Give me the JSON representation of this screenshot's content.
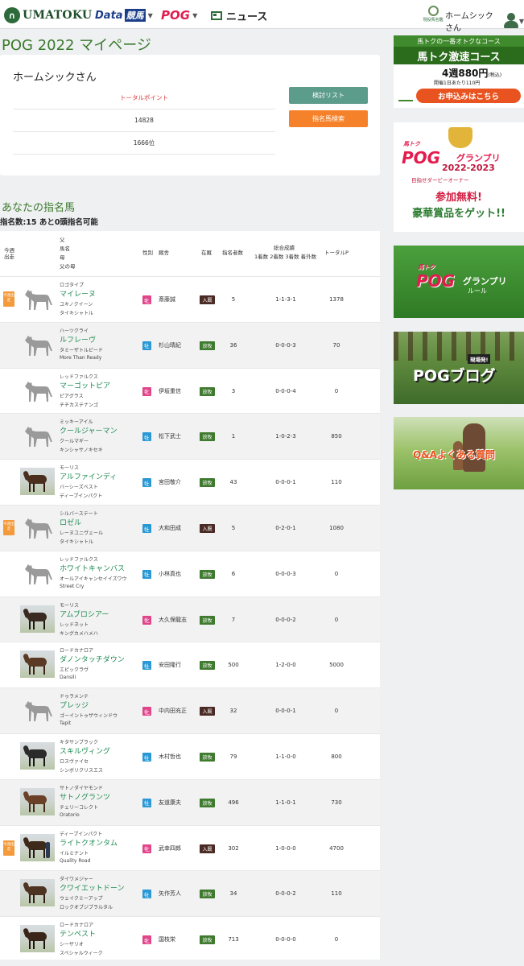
{
  "header": {
    "logo_text": "UMATOKU",
    "nav": [
      {
        "label": "Data",
        "sub": "競馬"
      },
      {
        "label": "POG"
      },
      {
        "label": "ニュース"
      }
    ],
    "corner_label": "現役馬名鑑",
    "user_name": "ホームシックさん"
  },
  "page_title": "POG 2022 マイページ",
  "profile": {
    "name": "ホームシックさん",
    "stat_label": "トータルポイント",
    "points": "14828",
    "rank": "1666位",
    "btn_list": "検討リスト",
    "btn_search": "指名馬検索"
  },
  "horses_section": {
    "title": "あなたの指名馬",
    "count_text": "指名数:15 あと0頭指名可能",
    "headers": {
      "konshu": "今週",
      "shusou": "出走",
      "sire": "父",
      "name": "馬名",
      "dam": "母",
      "damsire": "父の母",
      "sex": "性別",
      "trainer": "厩舎",
      "stable": "在厩",
      "noms": "指名者数",
      "record_title": "総合成績",
      "record_sub": "1着数 2着数 3着数 着外数",
      "points": "トータルP"
    }
  },
  "horses": [
    {
      "badge": "今週出走",
      "thumb": "silhouette",
      "sire": "ロゴタイプ",
      "name": "マイレーヌ",
      "dam": "ユキノクイーン",
      "damsire": "タイキシャトル",
      "sex": "牝",
      "trainer": "斎藤誠",
      "stable": "入厩",
      "noms": "5",
      "record": "1-1-3-1",
      "points": "1378"
    },
    {
      "badge": "",
      "thumb": "silhouette",
      "sire": "ハーツクライ",
      "name": "ルフレーヴ",
      "dam": "タミーザトルピード",
      "damsire": "More Than Ready",
      "sex": "牡",
      "trainer": "杉山晴紀",
      "stable": "放牧",
      "noms": "36",
      "record": "0-0-0-3",
      "points": "70"
    },
    {
      "badge": "",
      "thumb": "silhouette",
      "sire": "レッドファルクス",
      "name": "マーゴットピア",
      "dam": "ピアグラス",
      "damsire": "チチカステナンゴ",
      "sex": "牝",
      "trainer": "伊坂重信",
      "stable": "放牧",
      "noms": "3",
      "record": "0-0-0-4",
      "points": "0"
    },
    {
      "badge": "",
      "thumb": "silhouette",
      "sire": "ミッキーアイル",
      "name": "クールジャーマン",
      "dam": "クールマギー",
      "damsire": "キンシャサノキセキ",
      "sex": "牡",
      "trainer": "松下武士",
      "stable": "放牧",
      "noms": "1",
      "record": "1-0-2-3",
      "points": "850"
    },
    {
      "badge": "",
      "thumb": "photo",
      "sire": "モーリス",
      "name": "アルファインディ",
      "dam": "バーシーズベスト",
      "damsire": "ディープインパクト",
      "sex": "牡",
      "trainer": "宮田敬介",
      "stable": "放牧",
      "noms": "43",
      "record": "0-0-0-1",
      "points": "110"
    },
    {
      "badge": "今週出走",
      "thumb": "silhouette",
      "sire": "シルバーステート",
      "name": "ロゼル",
      "dam": "レーヌユニヴェール",
      "damsire": "タイキシャトル",
      "sex": "牡",
      "trainer": "大和田成",
      "stable": "入厩",
      "noms": "5",
      "record": "0-2-0-1",
      "points": "1080"
    },
    {
      "badge": "",
      "thumb": "silhouette",
      "sire": "レッドファルクス",
      "name": "ホワイトキャンバス",
      "dam": "オールアイキャンセイイズワウ",
      "damsire": "Street Cry",
      "sex": "牡",
      "trainer": "小林真也",
      "stable": "放牧",
      "noms": "6",
      "record": "0-0-0-3",
      "points": "0"
    },
    {
      "badge": "",
      "thumb": "photo",
      "sire": "モーリス",
      "name": "アムブロシアー",
      "dam": "レッドネット",
      "damsire": "キングカメハメハ",
      "sex": "牝",
      "trainer": "大久保龍志",
      "stable": "放牧",
      "noms": "7",
      "record": "0-0-0-2",
      "points": "0"
    },
    {
      "badge": "",
      "thumb": "photo",
      "sire": "ロードカナロア",
      "name": "ダノンタッチダウン",
      "dam": "エピックラヴ",
      "damsire": "Dansili",
      "sex": "牡",
      "trainer": "安田隆行",
      "stable": "放牧",
      "noms": "500",
      "record": "1-2-0-0",
      "points": "5000"
    },
    {
      "badge": "",
      "thumb": "silhouette",
      "sire": "ドゥラメンテ",
      "name": "プレッジ",
      "dam": "ゴーイントゥザウィンドウ",
      "damsire": "Tapit",
      "sex": "牝",
      "trainer": "中内田充正",
      "stable": "入厩",
      "noms": "32",
      "record": "0-0-0-1",
      "points": "0"
    },
    {
      "badge": "",
      "thumb": "photo",
      "sire": "キタサンブラック",
      "name": "スキルヴィング",
      "dam": "ロスヴァイセ",
      "damsire": "シンボリクリスエス",
      "sex": "牡",
      "trainer": "木村哲也",
      "stable": "放牧",
      "noms": "79",
      "record": "1-1-0-0",
      "points": "800"
    },
    {
      "badge": "",
      "thumb": "photo",
      "sire": "サトノダイヤモンド",
      "name": "サトノグランツ",
      "dam": "チェリーコレクト",
      "damsire": "Oratorio",
      "sex": "牡",
      "trainer": "友道康夫",
      "stable": "放牧",
      "noms": "496",
      "record": "1-1-0-1",
      "points": "730"
    },
    {
      "badge": "今週出走",
      "thumb": "photo",
      "sire": "ディープインパクト",
      "name": "ライトクオンタム",
      "dam": "イルミナント",
      "damsire": "Quality Road",
      "sex": "牝",
      "trainer": "武幸四郎",
      "stable": "入厩",
      "noms": "302",
      "record": "1-0-0-0",
      "points": "4700"
    },
    {
      "badge": "",
      "thumb": "photo",
      "sire": "ダイワメジャー",
      "name": "クワイエットドーン",
      "dam": "ウェイクミーアップ",
      "damsire": "ロックオブジブラルタル",
      "sex": "牡",
      "trainer": "矢作芳人",
      "stable": "放牧",
      "noms": "34",
      "record": "0-0-0-2",
      "points": "110"
    },
    {
      "badge": "",
      "thumb": "photo",
      "sire": "ロードカナロア",
      "name": "テンペスト",
      "dam": "シーザリオ",
      "damsire": "スペシャルウィーク",
      "sex": "牝",
      "trainer": "国枝栄",
      "stable": "放牧",
      "noms": "713",
      "record": "0-0-0-0",
      "points": "0"
    }
  ],
  "sidebar": {
    "ad1": {
      "top": "馬トクの一番オトクなコース",
      "title": "馬トク激速コース",
      "price": "4週880円",
      "price_note": "(税込)",
      "per_day": "開催1日あたり110円",
      "cta": "お申込みはこちら"
    },
    "ad2": {
      "pog": "POG",
      "gp": "グランプリ",
      "brand": "馬トク",
      "year": "2022-2023",
      "subtitle": "目指せダービーオーナー",
      "free": "参加無料!",
      "prize": "豪華賞品をゲット!!"
    },
    "ad3": {
      "pog": "POG",
      "gp": "グランプリ",
      "brand": "馬トク",
      "rule": "ルール"
    },
    "ad4": {
      "tag": "現場発!",
      "blog": "POGブログ"
    },
    "ad5": {
      "qa": "Q&Aよくある質問"
    }
  }
}
